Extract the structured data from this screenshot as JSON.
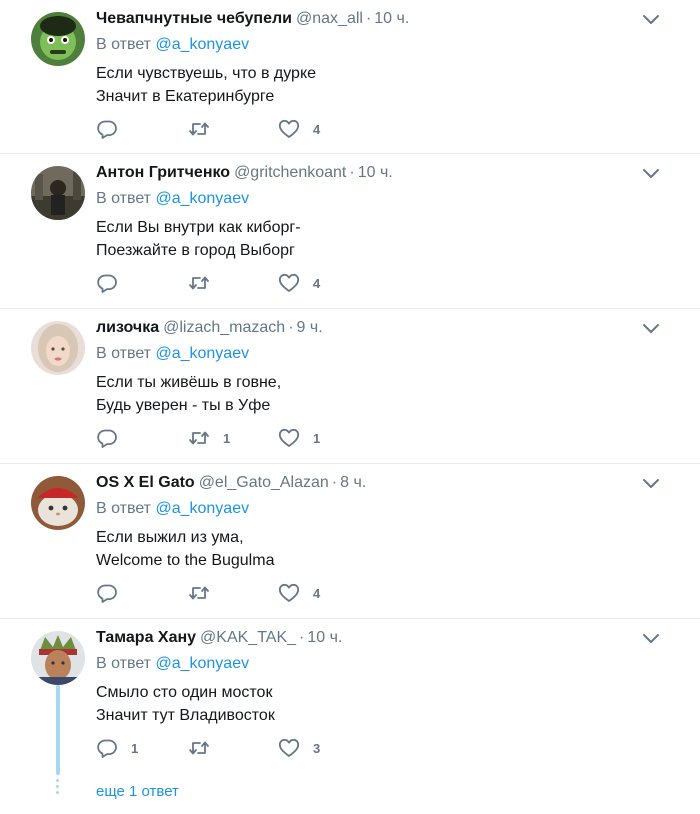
{
  "tweets": [
    {
      "name": "Чевапчнутные чебупели",
      "handle": "@nax_all",
      "dot": "·",
      "time": "10 ч.",
      "reply_prefix": "В ответ",
      "reply_to": "@a_konyaev",
      "line1": "Если чувствуешь, что в дурке",
      "line2": "Значит в Екатеринбурге",
      "reply_count": "",
      "retweet_count": "",
      "like_count": "4"
    },
    {
      "name": "Антон Гритченко",
      "handle": "@gritchenkoant",
      "dot": "·",
      "time": "10 ч.",
      "reply_prefix": "В ответ",
      "reply_to": "@a_konyaev",
      "line1": "Если Вы внутри как киборг-",
      "line2": "Поезжайте в город Выборг",
      "reply_count": "",
      "retweet_count": "",
      "like_count": "4"
    },
    {
      "name": "лизочка",
      "handle": "@lizach_mazach",
      "dot": "·",
      "time": "9 ч.",
      "reply_prefix": "В ответ",
      "reply_to": "@a_konyaev",
      "line1": "Если ты живёшь в говне,",
      "line2": "Будь уверен - ты в Уфе",
      "reply_count": "",
      "retweet_count": "1",
      "like_count": "1"
    },
    {
      "name": "OS X El Gato",
      "handle": "@el_Gato_Alazan",
      "dot": "·",
      "time": "8 ч.",
      "reply_prefix": "В ответ",
      "reply_to": "@a_konyaev",
      "line1": "Если выжил из ума,",
      "line2": "Welcome to the Bugulma",
      "reply_count": "",
      "retweet_count": "",
      "like_count": "4"
    },
    {
      "name": "Тамара Хану",
      "handle": "@KAK_TAK_",
      "dot": "·",
      "time": "10 ч.",
      "reply_prefix": "В ответ",
      "reply_to": "@a_konyaev",
      "line1": "Смыло сто один мосток",
      "line2": "Значит тут Владивосток",
      "reply_count": "1",
      "retweet_count": "",
      "like_count": "3"
    }
  ],
  "more_replies": "еще 1 ответ",
  "colors": {
    "link": "#1b95e0",
    "secondary": "#657786",
    "divider": "#e6ecf0",
    "thread": "#a8d7f4"
  },
  "icons": [
    "chevron-down-icon",
    "reply-icon",
    "retweet-icon",
    "like-icon"
  ]
}
